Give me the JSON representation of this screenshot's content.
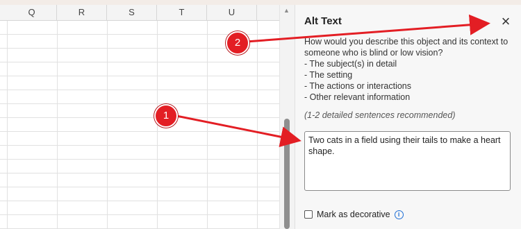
{
  "sheet": {
    "columns": [
      "Q",
      "R",
      "S",
      "T",
      "U"
    ]
  },
  "panel": {
    "title": "Alt Text",
    "close_symbol": "×",
    "description": [
      "How would you describe this object and its context to",
      "someone who is blind or low vision?",
      "- The subject(s) in detail",
      "- The setting",
      "- The actions or interactions",
      "- Other relevant information"
    ],
    "hint": "(1-2 detailed sentences recommended)",
    "alt_text_value": "Two cats in a field using their tails to make a heart shape.",
    "decorative_label": "Mark as decorative",
    "decorative_checked": false
  },
  "annotations": {
    "badge_1": "1",
    "badge_2": "2",
    "color": "#e31e24"
  },
  "icons": {
    "close": "close-icon",
    "info": "info-icon",
    "scroll_up": "scroll-up-arrow-icon"
  }
}
